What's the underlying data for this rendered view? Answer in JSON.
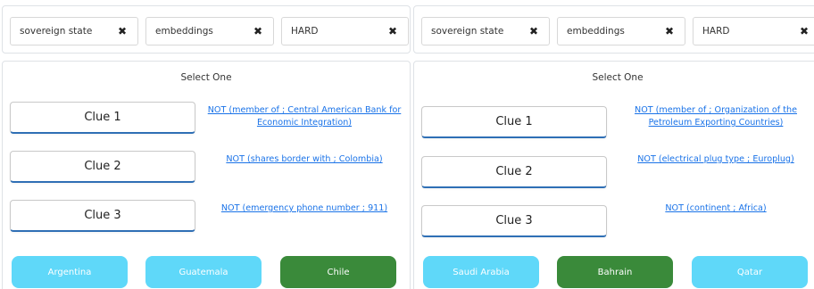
{
  "colors": {
    "answer_default": "#5fd8f9",
    "answer_selected": "#3a8a3a",
    "link": "#1a73e8",
    "clue_underline": "#2f6fb5"
  },
  "panels": [
    {
      "filters": [
        {
          "text": "sovereign state"
        },
        {
          "text": "embeddings"
        },
        {
          "text": "HARD"
        }
      ],
      "prompt": "Select One",
      "clues": [
        {
          "label": "Clue 1",
          "hint": "NOT (member of ; Central American Bank for Economic Integration)"
        },
        {
          "label": "Clue 2",
          "hint": "NOT (shares border with ; Colombia)"
        },
        {
          "label": "Clue 3",
          "hint": "NOT (emergency phone number ; 911)"
        }
      ],
      "answers": [
        {
          "label": "Argentina",
          "selected": false
        },
        {
          "label": "Guatemala",
          "selected": false
        },
        {
          "label": "Chile",
          "selected": true
        }
      ]
    },
    {
      "filters": [
        {
          "text": "sovereign state"
        },
        {
          "text": "embeddings"
        },
        {
          "text": "HARD"
        }
      ],
      "prompt": "Select One",
      "clues": [
        {
          "label": "Clue 1",
          "hint": "NOT (member of ; Organization of the Petroleum Exporting Countries)"
        },
        {
          "label": "Clue 2",
          "hint": "NOT (electrical plug type ; Europlug)"
        },
        {
          "label": "Clue 3",
          "hint": "NOT (continent ; Africa)"
        }
      ],
      "answers": [
        {
          "label": "Saudi Arabia",
          "selected": false
        },
        {
          "label": "Bahrain",
          "selected": true
        },
        {
          "label": "Qatar",
          "selected": false
        }
      ]
    }
  ]
}
